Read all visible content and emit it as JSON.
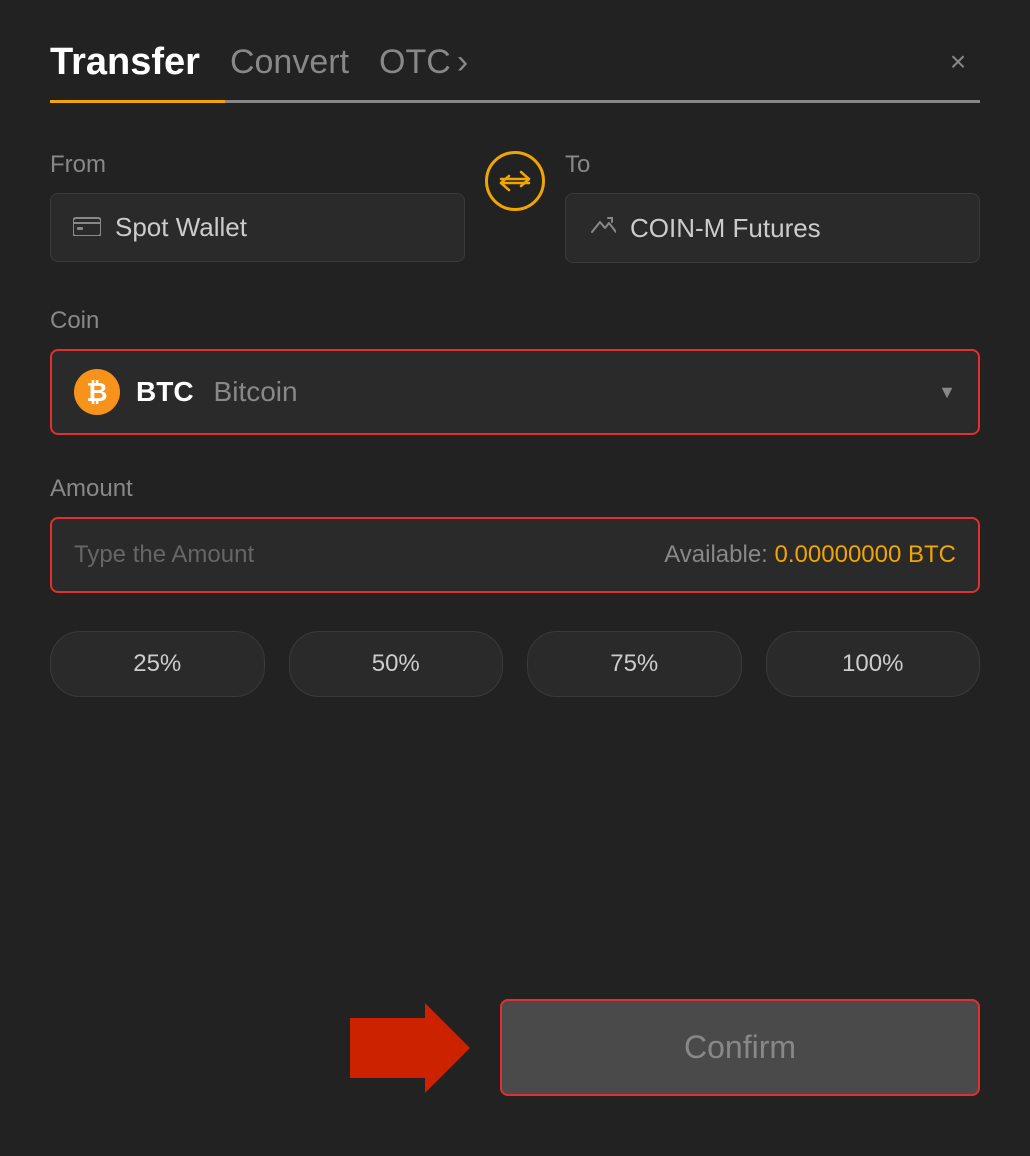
{
  "header": {
    "tab_transfer": "Transfer",
    "tab_convert": "Convert",
    "tab_otc": "OTC",
    "close_label": "×"
  },
  "from": {
    "label": "From",
    "wallet_name": "Spot Wallet"
  },
  "to": {
    "label": "To",
    "wallet_name": "COIN-M Futures"
  },
  "coin": {
    "label": "Coin",
    "symbol": "BTC",
    "full_name": "Bitcoin"
  },
  "amount": {
    "label": "Amount",
    "placeholder": "Type the Amount",
    "available_label": "Available:",
    "available_value": "0.00000000 BTC"
  },
  "percentages": [
    "25%",
    "50%",
    "75%",
    "100%"
  ],
  "confirm_button": "Confirm"
}
